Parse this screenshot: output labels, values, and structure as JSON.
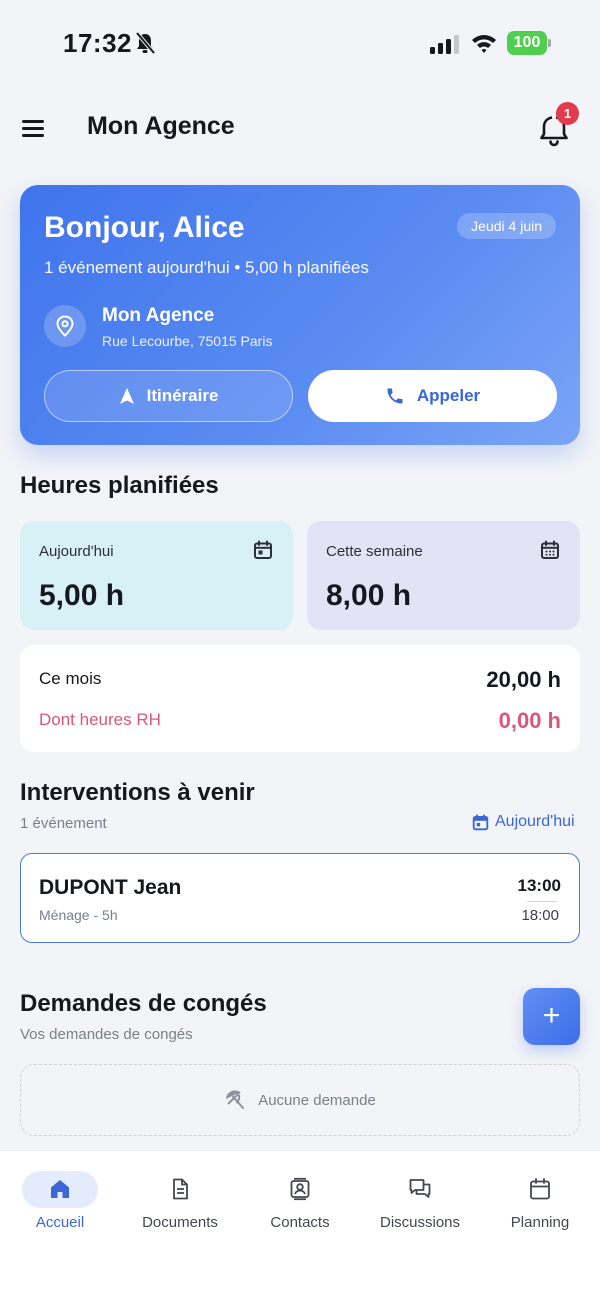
{
  "status_bar": {
    "time": "17:32",
    "battery": "100"
  },
  "header": {
    "title": "Mon Agence",
    "notification_count": "1"
  },
  "hero": {
    "greeting": "Bonjour, Alice",
    "date": "Jeudi 4 juin",
    "summary": "1 événement aujourd'hui • 5,00 h planifiées",
    "agency_name": "Mon Agence",
    "address": "Rue Lecourbe, 75015 Paris",
    "route_label": "Itinéraire",
    "call_label": "Appeler"
  },
  "hours": {
    "title": "Heures planifiées",
    "today_label": "Aujourd'hui",
    "today_value": "5,00 h",
    "week_label": "Cette semaine",
    "week_value": "8,00 h",
    "month_label": "Ce mois",
    "month_value": "20,00 h",
    "rh_label": "Dont heures RH",
    "rh_value": "0,00 h"
  },
  "interventions": {
    "title": "Interventions à venir",
    "count": "1 événement",
    "filter_label": "Aujourd'hui",
    "items": [
      {
        "name": "DUPONT Jean",
        "desc": "Ménage - 5h",
        "start": "13:00",
        "end": "18:00"
      }
    ]
  },
  "leave": {
    "title": "Demandes de congés",
    "subtitle": "Vos demandes de congés",
    "add_label": "+",
    "empty_label": "Aucune demande"
  },
  "nav": {
    "items": [
      {
        "label": "Accueil",
        "icon": "home-icon",
        "active": true
      },
      {
        "label": "Documents",
        "icon": "document-icon"
      },
      {
        "label": "Contacts",
        "icon": "contacts-icon"
      },
      {
        "label": "Discussions",
        "icon": "chat-icon"
      },
      {
        "label": "Planning",
        "icon": "calendar-icon"
      }
    ]
  },
  "colors": {
    "accent": "#3a66d6",
    "hero_start": "#3f74ec",
    "today_card": "#d8f1f6",
    "week_card": "#e2e3f4",
    "rh": "#d9577b",
    "badge": "#e33b4e"
  }
}
